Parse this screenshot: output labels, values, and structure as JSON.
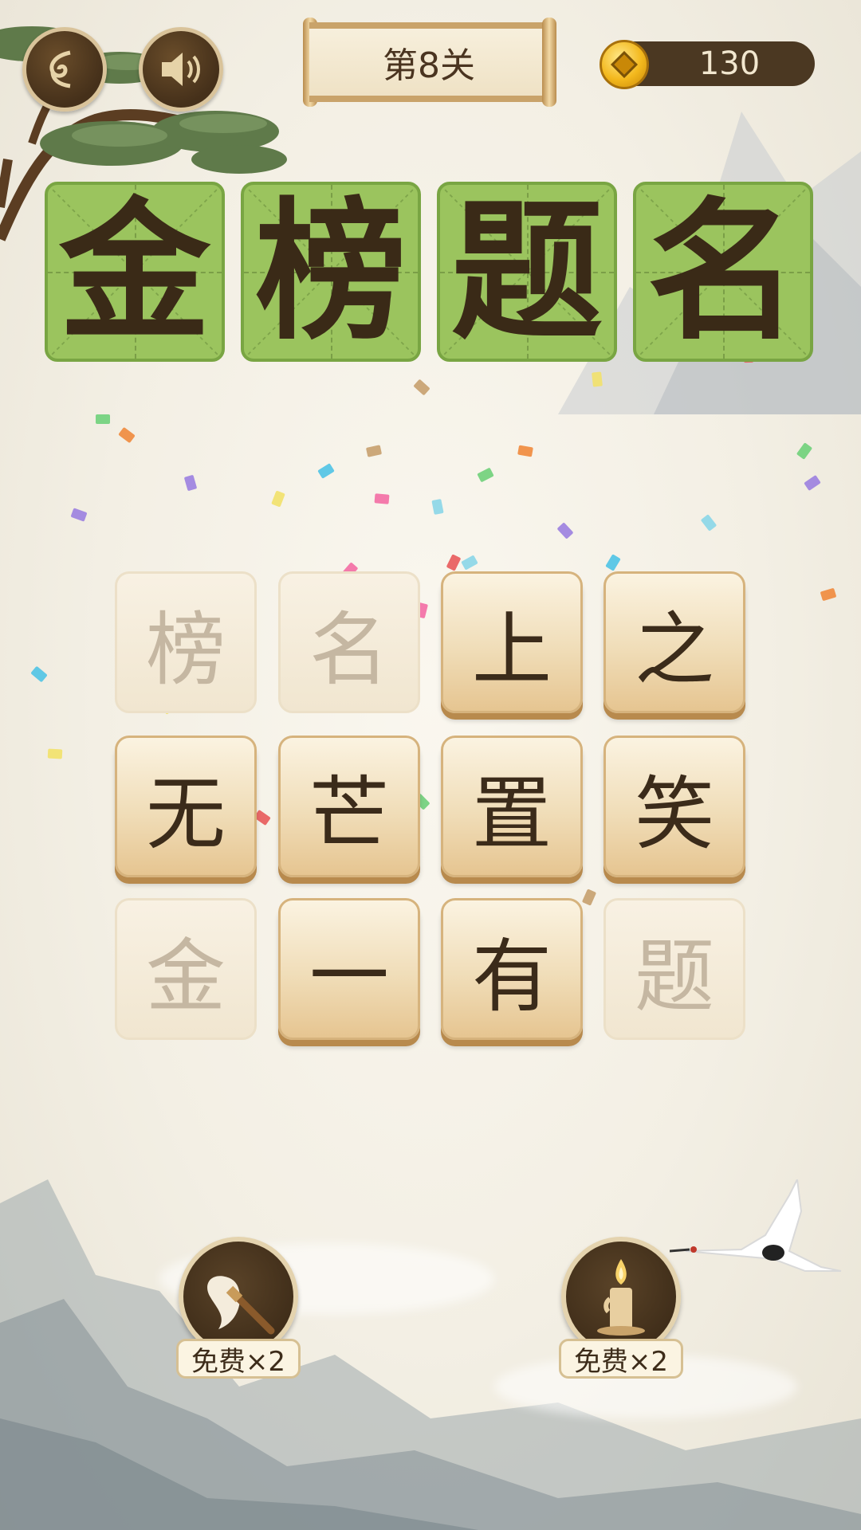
{
  "header": {
    "level_label": "第8关",
    "coins": "130",
    "back_icon": "ornate-back-icon",
    "sound_icon": "speaker-icon"
  },
  "answer": {
    "chars": [
      "金",
      "榜",
      "题",
      "名"
    ]
  },
  "grid": {
    "tiles": [
      {
        "char": "榜",
        "state": "used"
      },
      {
        "char": "名",
        "state": "used"
      },
      {
        "char": "上",
        "state": "active"
      },
      {
        "char": "之",
        "state": "active"
      },
      {
        "char": "无",
        "state": "active"
      },
      {
        "char": "芒",
        "state": "active"
      },
      {
        "char": "置",
        "state": "active"
      },
      {
        "char": "笑",
        "state": "active"
      },
      {
        "char": "金",
        "state": "used"
      },
      {
        "char": "一",
        "state": "active"
      },
      {
        "char": "有",
        "state": "active"
      },
      {
        "char": "题",
        "state": "used"
      }
    ]
  },
  "tools": {
    "brush": {
      "icon": "brush-icon",
      "badge": "免费×2"
    },
    "candle": {
      "icon": "candle-icon",
      "badge": "免费×2"
    }
  },
  "colors": {
    "answer_bg": "#9bc45e",
    "tile_active": "#f0ddb8",
    "tile_used": "#f1e6d0",
    "dark_brown": "#45301a"
  }
}
